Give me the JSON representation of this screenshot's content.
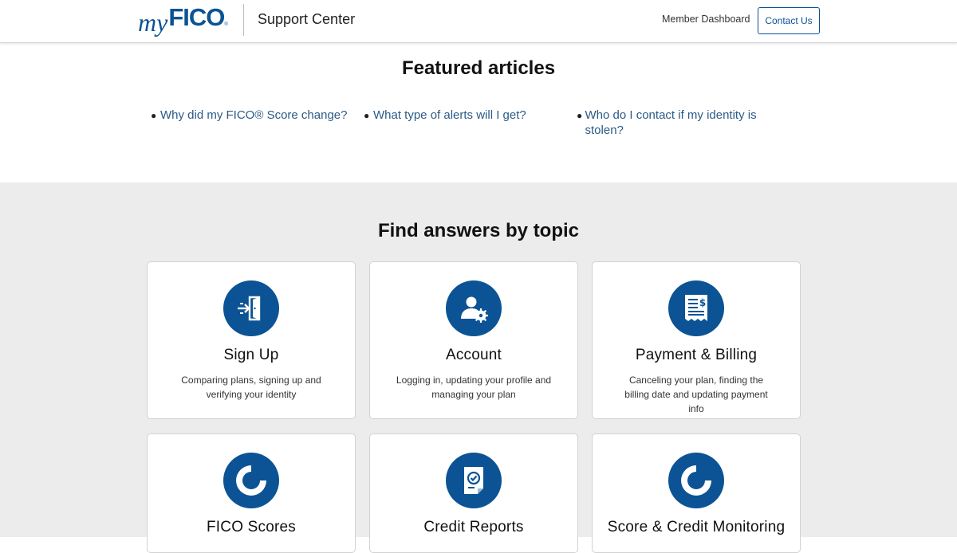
{
  "header": {
    "logo_my": "my",
    "logo_fico": "FICO",
    "logo_reg": "®",
    "title": "Support Center",
    "member_dashboard": "Member Dashboard",
    "contact_us": "Contact Us"
  },
  "featured": {
    "title": "Featured articles",
    "articles": [
      {
        "label": "Why did my FICO® Score change?"
      },
      {
        "label": "What type of alerts will I get?"
      },
      {
        "label": "Who do I contact if my identity is stolen?"
      }
    ]
  },
  "topics": {
    "title": "Find answers by topic",
    "cards": [
      {
        "title": "Sign Up",
        "desc": "Comparing plans, signing up and verifying your identity",
        "icon": "sign-in-door-icon"
      },
      {
        "title": "Account",
        "desc": "Logging in, updating your profile and managing your plan",
        "icon": "user-settings-icon"
      },
      {
        "title": "Payment & Billing",
        "desc": "Canceling your plan, finding the billing date and updating payment info",
        "icon": "billing-receipt-icon"
      },
      {
        "title": "FICO Scores",
        "desc": "",
        "icon": "score-gauge-icon"
      },
      {
        "title": "Credit Reports",
        "desc": "",
        "icon": "credit-report-check-icon"
      },
      {
        "title": "Score & Credit Monitoring",
        "desc": "",
        "icon": "monitoring-pulse-icon"
      }
    ]
  },
  "colors": {
    "brand_blue": "#0b5394",
    "link_blue": "#2b5a86",
    "section_gray": "#ececec"
  }
}
